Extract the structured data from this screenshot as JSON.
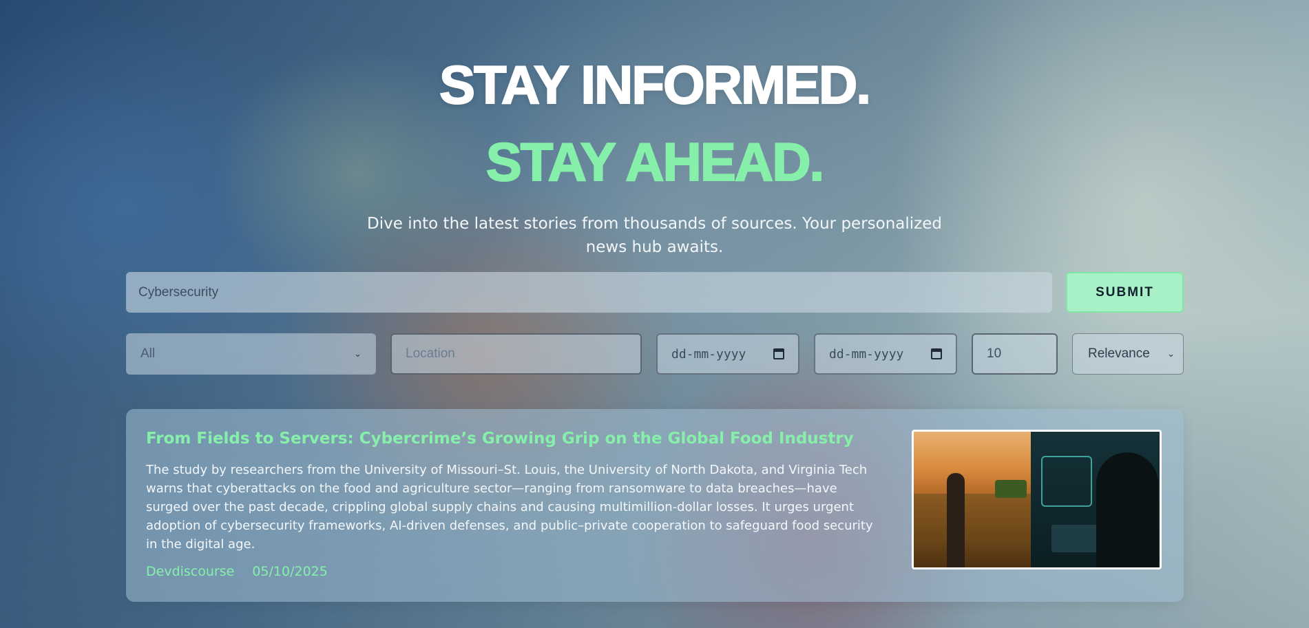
{
  "hero": {
    "headline_line1": "STAY INFORMED.",
    "headline_line2": "STAY AHEAD.",
    "subtitle": "Dive into the latest stories from thousands of sources. Your personalized news hub awaits."
  },
  "search": {
    "value": "Cybersecurity",
    "submit_label": "SUBMIT"
  },
  "filters": {
    "category_selected": "All",
    "location_placeholder": "Location",
    "date_from_placeholder": "dd-mm-yyyy",
    "date_to_placeholder": "dd-mm-yyyy",
    "count_value": "10",
    "sort_selected": "Relevance"
  },
  "articles": [
    {
      "title": "From Fields to Servers: Cybercrime’s Growing Grip on the Global Food Industry",
      "summary": "The study by researchers from the University of Missouri–St. Louis, the University of North Dakota, and Virginia Tech warns that cyberattacks on the food and agriculture sector—ranging from ransomware to data breaches—have surged over the past decade, crippling global supply chains and causing multimillion-dollar losses. It urges urgent adoption of cybersecurity frameworks, AI-driven defenses, and public–private cooperation to safeguard food security in the digital age.",
      "source": "Devdiscourse",
      "date": "05/10/2025"
    }
  ],
  "colors": {
    "accent": "#86f0aa",
    "submit_bg": "#a8f0c6"
  }
}
